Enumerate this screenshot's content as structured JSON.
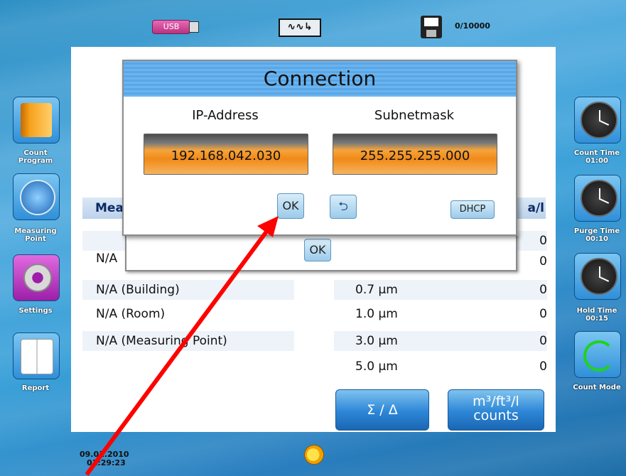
{
  "topbar": {
    "usb_label": "USB",
    "wave_glyph": "∿∿↳",
    "memory": "0/10000"
  },
  "sidebar": {
    "items": [
      {
        "label_line1": "Count",
        "label_line2": "Program",
        "icon": "book-icon"
      },
      {
        "label_line1": "Measuring",
        "label_line2": "Point",
        "icon": "compass-icon"
      },
      {
        "label_line1": "Settings",
        "label_line2": "",
        "icon": "gear-icon"
      },
      {
        "label_line1": "Report",
        "label_line2": "",
        "icon": "report-icon"
      }
    ]
  },
  "rightbar": {
    "count_time": {
      "label": "Count Time",
      "value": "01:00"
    },
    "purge_time": {
      "label": "Purge Time",
      "value": "00:10"
    },
    "hold_time": {
      "label": "Hold Time",
      "value": "00:15"
    },
    "count_mode": {
      "label": "Count Mode"
    }
  },
  "table": {
    "header_left": "Mea",
    "header_right": "a/l",
    "left_rows": [
      "N/A",
      "N/A (Building)",
      "N/A (Room)",
      "N/A (Measuring Point)"
    ],
    "sizes": [
      "0.7 µm",
      "1.0 µm",
      "3.0 µm",
      "5.0 µm"
    ],
    "values": [
      "0",
      "0",
      "0",
      "0",
      "0",
      "0"
    ]
  },
  "buttons": {
    "sigma_delta": "Σ / Δ",
    "units_line1": "m³/ft³/l",
    "units_line2": "counts"
  },
  "status": {
    "date": "09.01.2010",
    "time": "01:29:23"
  },
  "dialog": {
    "title": "Connection",
    "ip_label": "IP-Address",
    "ip_value": "192.168.042.030",
    "subnet_label": "Subnetmask",
    "subnet_value": "255.255.255.000",
    "ok_label": "OK",
    "back_glyph": "⮌",
    "dhcp_label": "DHCP"
  },
  "back_dialog": {
    "ok_label": "OK"
  },
  "colors": {
    "accent_orange": "#f08a18",
    "title_blue": "#58a7e8",
    "arrow_red": "#ff0000"
  }
}
